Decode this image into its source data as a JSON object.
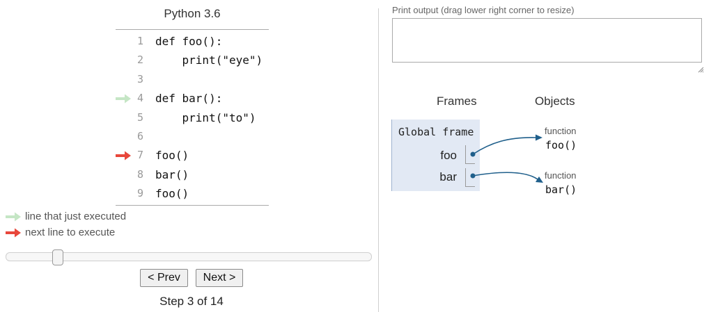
{
  "code_panel": {
    "language": "Python 3.6",
    "lines": [
      {
        "num": "1",
        "text": "def foo():",
        "marker": "none"
      },
      {
        "num": "2",
        "text": "    print(\"eye\")",
        "marker": "none"
      },
      {
        "num": "3",
        "text": "",
        "marker": "none"
      },
      {
        "num": "4",
        "text": "def bar():",
        "marker": "just-executed"
      },
      {
        "num": "5",
        "text": "    print(\"to\")",
        "marker": "none"
      },
      {
        "num": "6",
        "text": "",
        "marker": "none"
      },
      {
        "num": "7",
        "text": "foo()",
        "marker": "next"
      },
      {
        "num": "8",
        "text": "bar()",
        "marker": "none"
      },
      {
        "num": "9",
        "text": "foo()",
        "marker": "none"
      }
    ]
  },
  "legend": {
    "just_executed": "line that just executed",
    "next_line": "next line to execute"
  },
  "colors": {
    "just_executed_arrow": "#c5e6c5",
    "next_line_arrow": "#e8473b",
    "frame_bg": "#e2e9f4",
    "pointer": "#1f5f8b"
  },
  "navigation": {
    "prev_label": "< Prev",
    "next_label": "Next >",
    "step_text": "Step 3 of 14",
    "current_step": 3,
    "total_steps": 14
  },
  "output": {
    "label": "Print output (drag lower right corner to resize)",
    "text": ""
  },
  "visualization": {
    "frames_header": "Frames",
    "objects_header": "Objects",
    "global_frame": {
      "title": "Global frame",
      "variables": [
        {
          "name": "foo"
        },
        {
          "name": "bar"
        }
      ]
    },
    "objects": [
      {
        "type": "function",
        "name": "foo()"
      },
      {
        "type": "function",
        "name": "bar()"
      }
    ]
  }
}
